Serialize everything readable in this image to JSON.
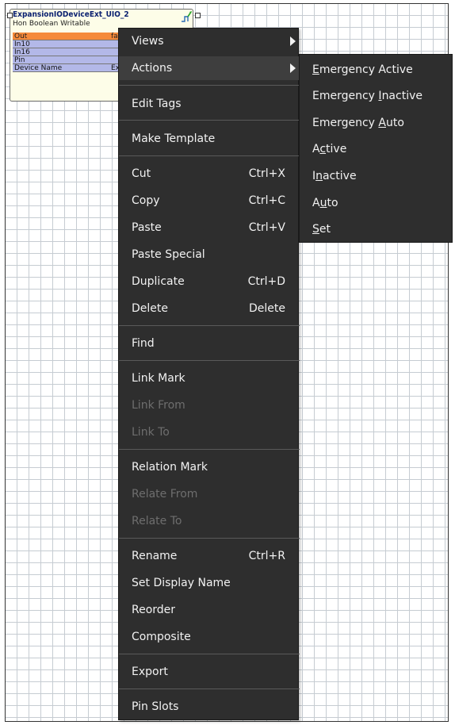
{
  "block": {
    "title": "ExpansionIODeviceExt_UIO_2",
    "subtitle": "Hon Boolean Writable",
    "slots": [
      {
        "name": "Out",
        "value": "false"
      },
      {
        "name": "In10",
        "value": ""
      },
      {
        "name": "In16",
        "value": ""
      },
      {
        "name": "Pin",
        "value": ""
      },
      {
        "name": "Device Name",
        "value": "Exp"
      }
    ]
  },
  "menu": {
    "views": "Views",
    "actions": "Actions",
    "edit_tags": "Edit Tags",
    "make_template": "Make Template",
    "cut": "Cut",
    "cut_sc": "Ctrl+X",
    "copy": "Copy",
    "copy_sc": "Ctrl+C",
    "paste": "Paste",
    "paste_sc": "Ctrl+V",
    "paste_special": "Paste Special",
    "duplicate": "Duplicate",
    "duplicate_sc": "Ctrl+D",
    "delete": "Delete",
    "delete_sc": "Delete",
    "find": "Find",
    "link_mark": "Link Mark",
    "link_from": "Link From",
    "link_to": "Link To",
    "relation_mark": "Relation Mark",
    "relate_from": "Relate From",
    "relate_to": "Relate To",
    "rename": "Rename",
    "rename_sc": "Ctrl+R",
    "set_display_name": "Set Display Name",
    "reorder": "Reorder",
    "composite": "Composite",
    "export": "Export",
    "pin_slots": "Pin Slots"
  },
  "submenu": {
    "emergency_active_a": "E",
    "emergency_active_b": "mergency Active",
    "emergency_inactive_a": "Emergency ",
    "emergency_inactive_u": "I",
    "emergency_inactive_b": "nactive",
    "emergency_auto_a": "Emergency ",
    "emergency_auto_u": "A",
    "emergency_auto_b": "uto",
    "active_a": "A",
    "active_u": "c",
    "active_b": "tive",
    "inactive_a": "I",
    "inactive_u": "n",
    "inactive_b": "active",
    "auto_a": "A",
    "auto_u": "u",
    "auto_b": "to",
    "set_u": "S",
    "set_b": "et"
  },
  "colors": {
    "menu_bg": "#2e2e2e",
    "out_slot": "#f58a3a",
    "in_slot": "#b3b8e8",
    "block_bg": "#fdfde8"
  }
}
